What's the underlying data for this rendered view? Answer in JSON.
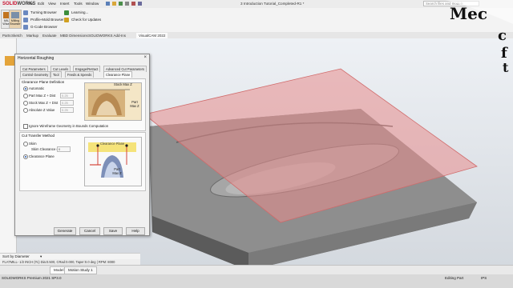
{
  "app": {
    "logo_brand": "SOLID",
    "logo_rest": "WORKS",
    "document_title": "3 Introduction Tutorial_Completed-R1 *",
    "search_placeholder": "Search files and models",
    "menus": [
      "File",
      "Edit",
      "View",
      "Insert",
      "Tools",
      "Window"
    ]
  },
  "ribbon": {
    "big_buttons": [
      "MILL Wizard",
      "Milling Browser"
    ],
    "items": [
      "Turning Browser",
      "Profile-Mold Browser",
      "G-Code Browser",
      "Learning...",
      "Check for Updates"
    ]
  },
  "tabs": [
    "Parts",
    "Sketch",
    "Markup",
    "Evaluate",
    "MBD Dimensions",
    "SOLIDWORKS Add-Ins",
    "VisualCAM 2022"
  ],
  "dialog": {
    "title": "Horizontal Roughing",
    "tabs_row1": [
      "Cut Parameters",
      "Cut Levels",
      "Engage/Retract",
      "Advanced Cut Parameters"
    ],
    "tabs_row2": [
      "Control Geometry",
      "Tool",
      "Feeds & Speeds",
      "Clearance Plane"
    ],
    "plane_group_title": "Clearance Plane Definition",
    "plane_options": [
      {
        "label": "Automatic",
        "value": ""
      },
      {
        "label": "Part Max Z + Dist",
        "value": "0.25"
      },
      {
        "label": "Stock Max Z + Dist",
        "value": "0.25"
      },
      {
        "label": "Absolute Z Value",
        "value": "0.25"
      }
    ],
    "plane_selected": "Automatic",
    "picture_top": {
      "stock_label": "Stock Max Z",
      "part_label": "Part Max Z"
    },
    "ignore_wireframe_label": "Ignore Wireframe Geometry in Bounds Computation",
    "transfer_group_title": "Cut Transfer Method",
    "skim_label": "Skim",
    "skim_clearance_label": "Skim Clearance (C)",
    "skim_clearance_value": "0",
    "clearance_plane_label": "Clearance Plane",
    "transfer_selected": "Clearance Plane",
    "picture_bottom": {
      "plane_label": "Clearance Plane",
      "part_label": "Part Max Z"
    },
    "buttons": [
      "Generate",
      "Cancel",
      "Save",
      "Help"
    ]
  },
  "left_panel": {
    "sort_label": "Sort by Diameter",
    "sort_value": "",
    "tool_info": "FLATMILL- 1/2 INCH (#1) Dia:0.500, CRad:0.000, Taper:0.0 deg | RPM: 8000"
  },
  "bottom_tabs": [
    "Model",
    "Motion Study 1"
  ],
  "status": {
    "product": "SOLIDWORKS Premium 2021 SP3.0",
    "mode": "Editing Part",
    "units": "IPS"
  },
  "watermark_text": "Mec...",
  "colors": {
    "plane_fill": "#e88c8c",
    "model_gray": "#8e8e8e",
    "brand_red": "#c8102e",
    "accent_orange": "#e4a43a"
  }
}
